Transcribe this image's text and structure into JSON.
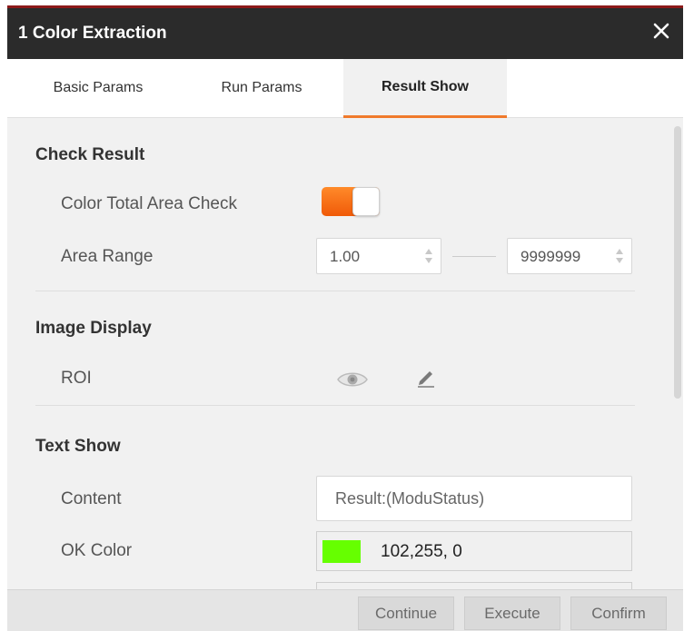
{
  "window": {
    "title": "1 Color Extraction"
  },
  "tabs": [
    {
      "label": "Basic Params",
      "active": false
    },
    {
      "label": "Run Params",
      "active": false
    },
    {
      "label": "Result Show",
      "active": true
    }
  ],
  "check_result": {
    "title": "Check Result",
    "color_total_area_check": {
      "label": "Color Total Area Check",
      "enabled": true
    },
    "area_range": {
      "label": "Area Range",
      "min": "1.00",
      "max": "9999999"
    }
  },
  "image_display": {
    "title": "Image Display",
    "roi": {
      "label": "ROI",
      "icons": [
        "eye-icon",
        "pencil-icon"
      ]
    }
  },
  "text_show": {
    "title": "Text Show",
    "content": {
      "label": "Content",
      "value": "Result:(ModuStatus)"
    },
    "ok_color": {
      "label": "OK Color",
      "value": "102,255,  0",
      "swatch": "#66ff00"
    },
    "ng_color": {
      "swatch": "#e01818"
    }
  },
  "footer": {
    "continue": "Continue",
    "execute": "Execute",
    "confirm": "Confirm"
  },
  "colors": {
    "accent": "#f07a2c",
    "titlebar": "#2b2b2b",
    "window_border": "#8c1a1a"
  }
}
